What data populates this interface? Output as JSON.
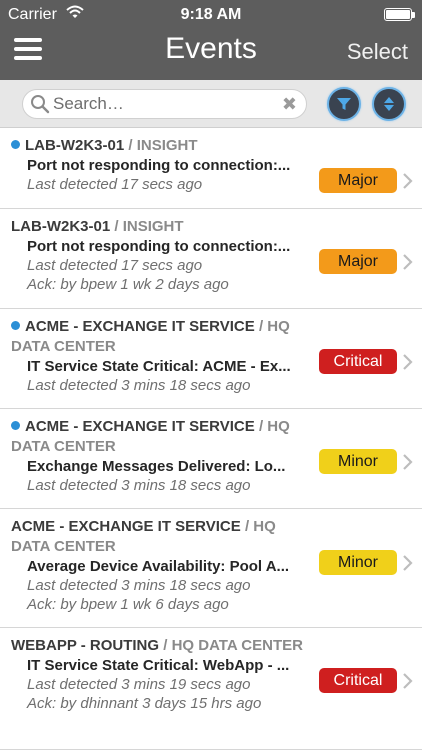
{
  "status_bar": {
    "carrier": "Carrier",
    "time": "9:18 AM",
    "wifi_icon": "wifi-icon",
    "battery_icon": "battery-icon"
  },
  "nav": {
    "title": "Events",
    "select_label": "Select",
    "menu_icon": "hamburger-menu-icon"
  },
  "search": {
    "placeholder": "Search…",
    "value": "",
    "search_icon": "search-icon",
    "clear_icon": "clear-icon",
    "filter_icon": "filter-icon",
    "sort_icon": "sort-icon"
  },
  "colors": {
    "header_bg": "#5d5d5d",
    "unread_dot": "#2c8fd6",
    "major": "#f39a1a",
    "minor": "#f0d01a",
    "critical": "#cf1f1f"
  },
  "events": [
    {
      "unread": true,
      "device": "LAB-W2K3-01",
      "source": "INSIGHT",
      "message": "Port not responding to connection:...",
      "detected": "Last detected 17 secs ago",
      "ack": "",
      "severity": "Major",
      "severity_class": "major"
    },
    {
      "unread": false,
      "device": "LAB-W2K3-01",
      "source": "INSIGHT",
      "message": "Port not responding to connection:...",
      "detected": "Last detected 17 secs ago",
      "ack": "Ack: by bpew 1 wk 2 days ago",
      "severity": "Major",
      "severity_class": "major"
    },
    {
      "unread": true,
      "device": "ACME - EXCHANGE IT SERVICE",
      "source": "HQ DATA CENTER",
      "message": "IT Service State Critical: ACME - Ex...",
      "detected": "Last detected 3 mins 18 secs ago",
      "ack": "",
      "severity": "Critical",
      "severity_class": "critical"
    },
    {
      "unread": true,
      "device": "ACME - EXCHANGE IT SERVICE",
      "source": "HQ DATA CENTER",
      "message": "Exchange Messages Delivered: Lo...",
      "detected": "Last detected 3 mins 18 secs ago",
      "ack": "",
      "severity": "Minor",
      "severity_class": "minor"
    },
    {
      "unread": false,
      "device": "ACME - EXCHANGE IT SERVICE",
      "source": "HQ DATA CENTER",
      "message": "Average Device Availability: Pool A...",
      "detected": "Last detected 3 mins 18 secs ago",
      "ack": "Ack: by bpew 1 wk 6 days ago",
      "severity": "Minor",
      "severity_class": "minor"
    },
    {
      "unread": false,
      "device": "WEBAPP - ROUTING",
      "source": "HQ DATA CENTER",
      "message": "IT Service State Critical: WebApp - ...",
      "detected": "Last detected 3 mins 19 secs ago",
      "ack": "Ack: by dhinnant 3 days 15 hrs ago",
      "severity": "Critical",
      "severity_class": "critical"
    }
  ]
}
